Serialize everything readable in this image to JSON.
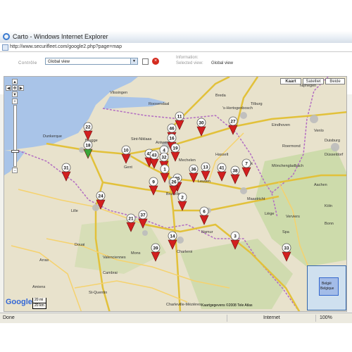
{
  "window": {
    "title": "Carto - Windows Internet Explorer"
  },
  "address": {
    "url": "http://www.securifleet.com/google2.php?page=map"
  },
  "controls": {
    "label": "Contrôle",
    "select_value": "Global view",
    "info_label": "Information:",
    "selected_view_label": "Selected view:",
    "selected_view_value": "Global view"
  },
  "map_types": {
    "kaart": "Kaart",
    "satelliet": "Satelliet",
    "beide": "Beide"
  },
  "nav": {
    "up": "▲",
    "left": "◀",
    "right": "▶",
    "down": "▼",
    "center": "✥",
    "zoom_in": "+",
    "zoom_out": "−"
  },
  "map": {
    "google": "Google",
    "scale_miles": "20 mi",
    "scale_km": "20 km",
    "copyright": "Kaartgegevens ©2008 Tele Atlas",
    "places": [
      "Vlissingen",
      "Breda",
      "'s-Hertogenbosch",
      "Nijmegen",
      "Roosendaal",
      "Tilburg",
      "Eindhoven",
      "Venlo",
      "Duisburg",
      "Düsseldorf",
      "Brugge",
      "Gent",
      "Antwerpen",
      "Mönchengladbach",
      "Dunkerque",
      "Leuven",
      "Maastricht",
      "Aachen",
      "Lille",
      "Bruxelles",
      "Liège",
      "Namur",
      "Charleroi",
      "Mons",
      "Valenciennes",
      "Arras",
      "Douai",
      "Cambrai",
      "Amiens",
      "St-Quentin",
      "Charleville-Mézières",
      "Hasselt",
      "Mechelen",
      "Sint-Niklaas",
      "Genk",
      "Roermond",
      "Köln",
      "Bonn",
      "Verviers",
      "Spa"
    ],
    "inset": {
      "label1": "België",
      "label2": "Belgique"
    },
    "markers": [
      {
        "label": "22",
        "color": "#d21f1f"
      },
      {
        "label": "18",
        "color": "#3aa63a"
      },
      {
        "label": "31",
        "color": "#d21f1f"
      },
      {
        "label": "10",
        "color": "#d21f1f"
      },
      {
        "label": "11",
        "color": "#d21f1f"
      },
      {
        "label": "30",
        "color": "#d21f1f"
      },
      {
        "label": "27",
        "color": "#d21f1f"
      },
      {
        "label": "46",
        "color": "#d21f1f"
      },
      {
        "label": "16",
        "color": "#d21f1f"
      },
      {
        "label": "42",
        "color": "#d21f1f"
      },
      {
        "label": "43",
        "color": "#d21f1f"
      },
      {
        "label": "4",
        "color": "#d21f1f"
      },
      {
        "label": "32",
        "color": "#d21f1f"
      },
      {
        "label": "19",
        "color": "#d21f1f"
      },
      {
        "label": "1",
        "color": "#d21f1f"
      },
      {
        "label": "36",
        "color": "#d21f1f"
      },
      {
        "label": "13",
        "color": "#d21f1f"
      },
      {
        "label": "41",
        "color": "#d21f1f"
      },
      {
        "label": "38",
        "color": "#d21f1f"
      },
      {
        "label": "7",
        "color": "#d21f1f"
      },
      {
        "label": "9",
        "color": "#d21f1f"
      },
      {
        "label": "25",
        "color": "#d21f1f"
      },
      {
        "label": "26",
        "color": "#d21f1f"
      },
      {
        "label": "2",
        "color": "#d21f1f"
      },
      {
        "label": "24",
        "color": "#d21f1f"
      },
      {
        "label": "6",
        "color": "#d21f1f"
      },
      {
        "label": "21",
        "color": "#d21f1f"
      },
      {
        "label": "37",
        "color": "#d21f1f"
      },
      {
        "label": "14",
        "color": "#d21f1f"
      },
      {
        "label": "3",
        "color": "#d21f1f"
      },
      {
        "label": "33",
        "color": "#d21f1f"
      },
      {
        "label": "39",
        "color": "#d21f1f"
      }
    ]
  },
  "status": {
    "done": "Done",
    "zone": "Internet",
    "zoom": "100%"
  },
  "colors": {
    "water": "#a9c4e8",
    "land": "#e8e2cc",
    "green": "#c6d9a2",
    "motorway": "#e2c13a",
    "road": "#f5d26e",
    "border": "#b26cc2"
  }
}
